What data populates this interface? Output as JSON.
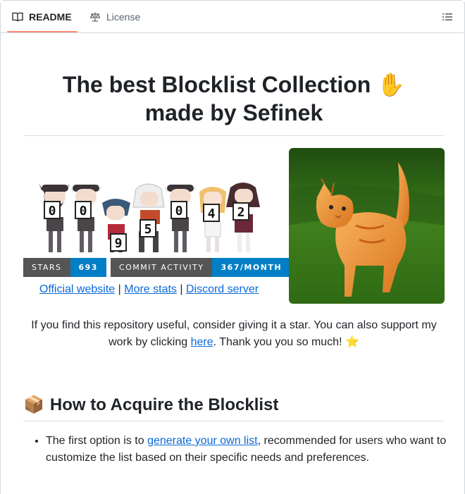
{
  "tabs": {
    "readme": "README",
    "license": "License"
  },
  "title": {
    "line1": "The best Blocklist Collection ✋",
    "line2": "made by Sefinek"
  },
  "counter": {
    "digits": [
      "0",
      "0",
      "9",
      "5",
      "0",
      "4",
      "2"
    ]
  },
  "badges": [
    {
      "key": "STARS",
      "value": "693"
    },
    {
      "key": "COMMIT ACTIVITY",
      "value": "367/MONTH"
    }
  ],
  "links": {
    "official": "Official website",
    "sep1": " | ",
    "stats": "More stats",
    "sep2": " | ",
    "discord": "Discord server"
  },
  "support": {
    "before": "If you find this repository useful, consider giving it a star. You can also support my work by clicking ",
    "link": "here",
    "after": ". Thank you you so much! ⭐"
  },
  "section": {
    "icon": "📦",
    "title": "How to Acquire the Blocklist"
  },
  "list": [
    {
      "before": "The first option is to ",
      "link": "generate your own list",
      "after": ", recommended for users who want to customize the list based on their specific needs and preferences."
    }
  ],
  "colors": {
    "accent": "#fd8c73",
    "link": "#0969da",
    "badge_key": "#555555",
    "badge_value": "#007ec6"
  }
}
